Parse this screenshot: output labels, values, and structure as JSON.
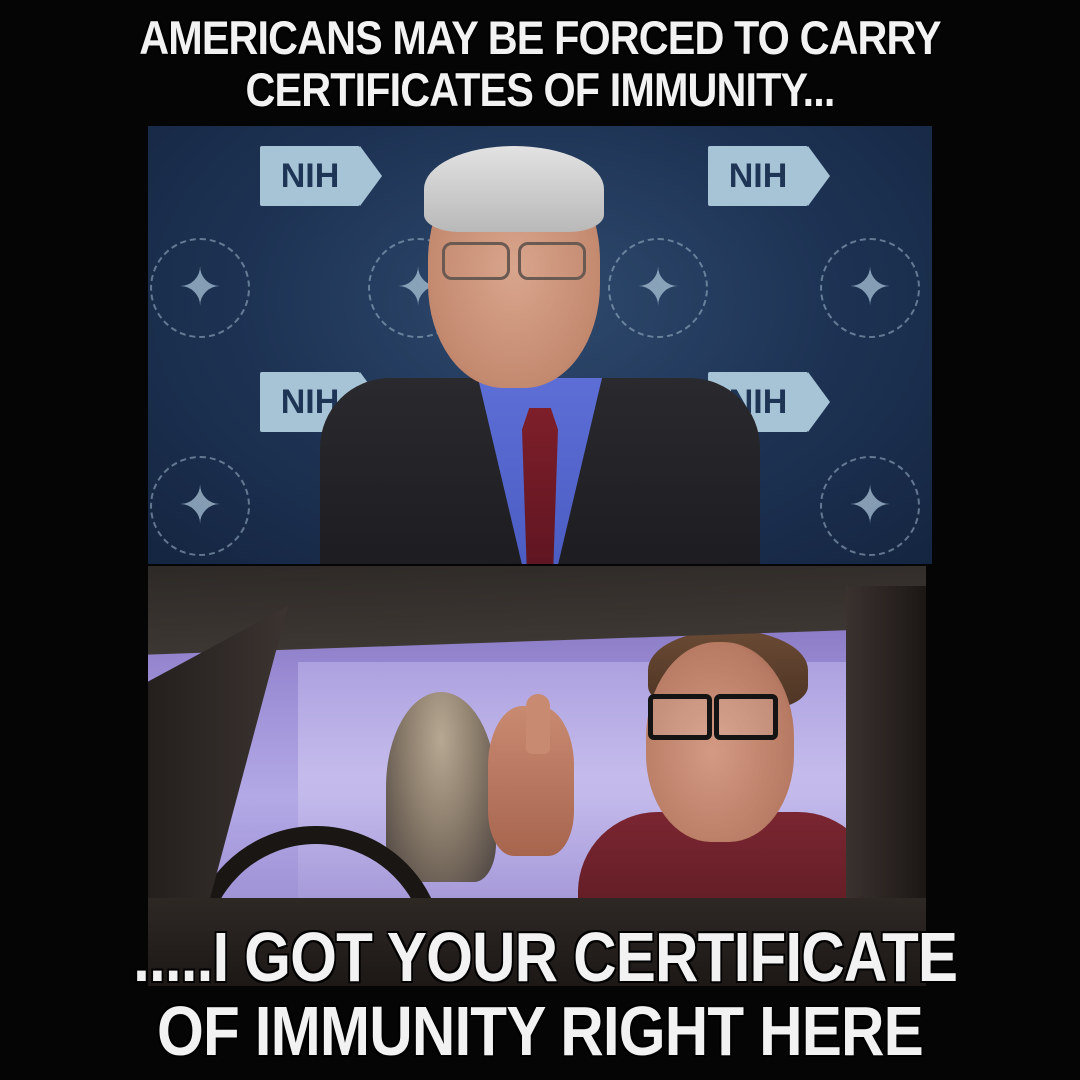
{
  "meme": {
    "top_caption_line1": "AMERICANS MAY BE FORCED TO CARRY",
    "top_caption_line2": "CERTIFICATES OF IMMUNITY...",
    "bottom_caption_line1": ".....I GOT YOUR CERTIFICATE",
    "bottom_caption_line2": "OF IMMUNITY RIGHT HERE"
  },
  "top_panel": {
    "backdrop_logo_text": "NIH",
    "seal_icon": "hhs-eagle-seal-icon"
  },
  "colors": {
    "background": "#050505",
    "caption_text": "#f2f2f2",
    "backdrop_blue": "#1d3253",
    "nih_logo": "#a7c4d6",
    "window_purple": "#9d8fd6"
  }
}
